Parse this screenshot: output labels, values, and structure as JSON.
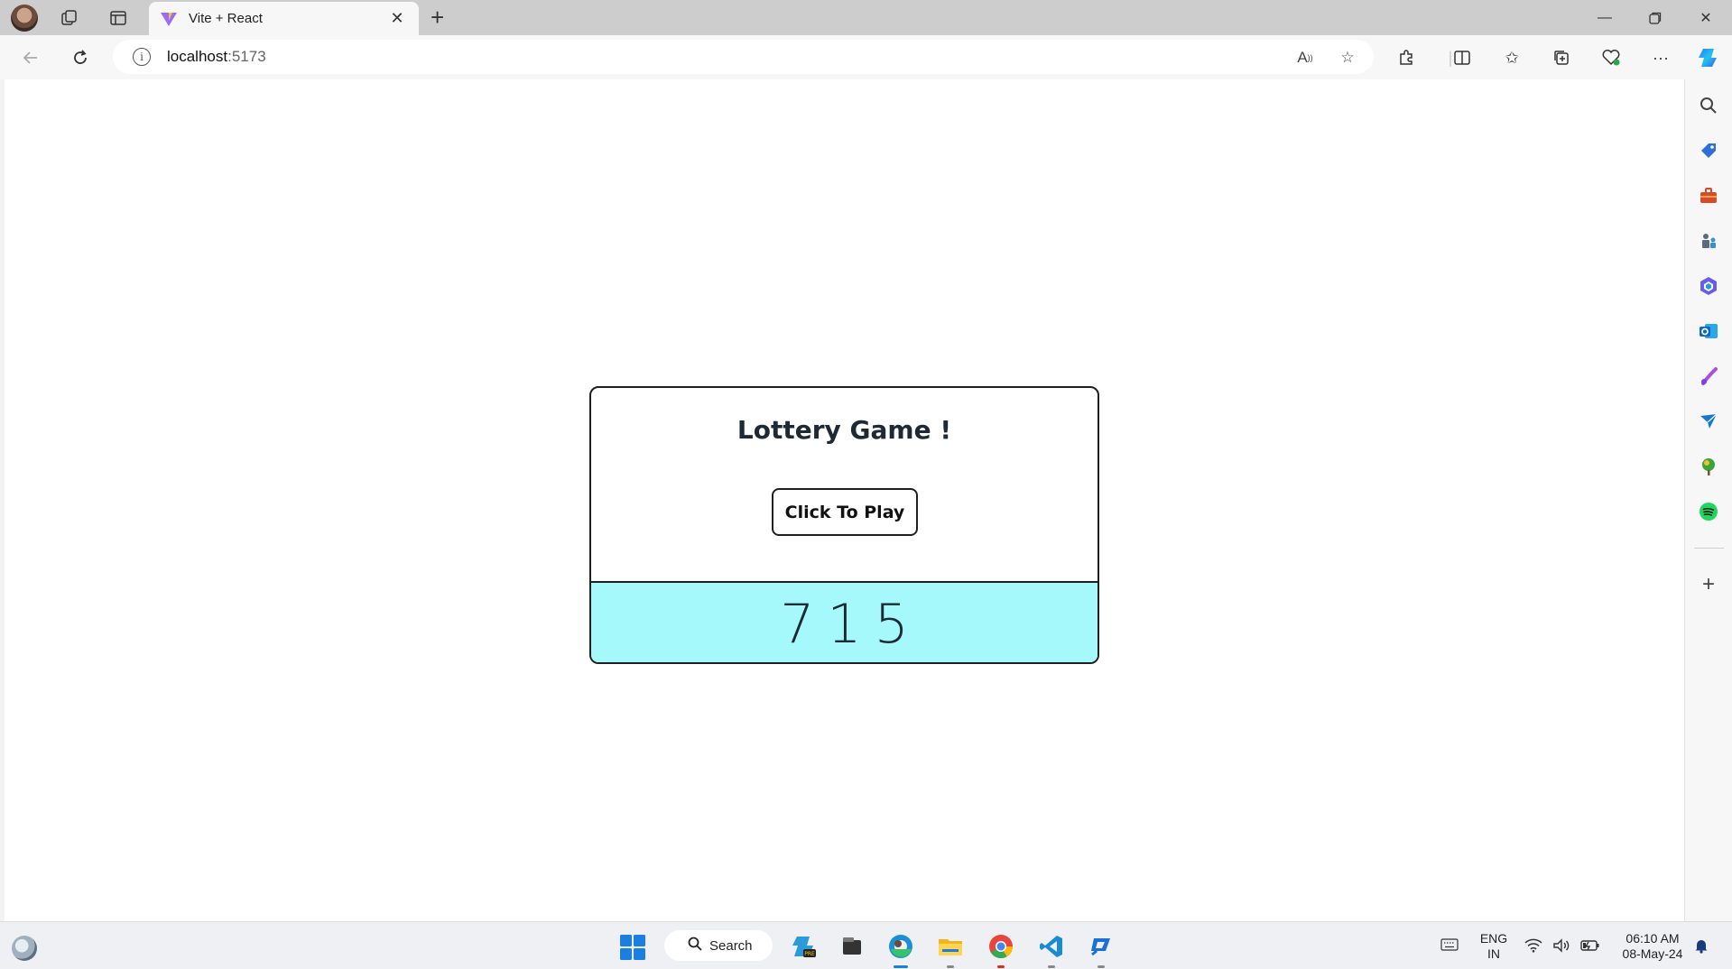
{
  "browser": {
    "tab_title": "Vite + React",
    "url_host": "localhost",
    "url_port": ":5173"
  },
  "page": {
    "heading": "Lottery Game !",
    "play_button_label": "Click To Play",
    "ticket_digits": [
      "7",
      "1",
      "5"
    ]
  },
  "colors": {
    "ticket_background": "#a6f9fa",
    "heading_text": "#1d2a36"
  },
  "taskbar": {
    "search_label": "Search",
    "language_line1": "ENG",
    "language_line2": "IN",
    "time": "06:10 AM",
    "date": "08-May-24"
  }
}
